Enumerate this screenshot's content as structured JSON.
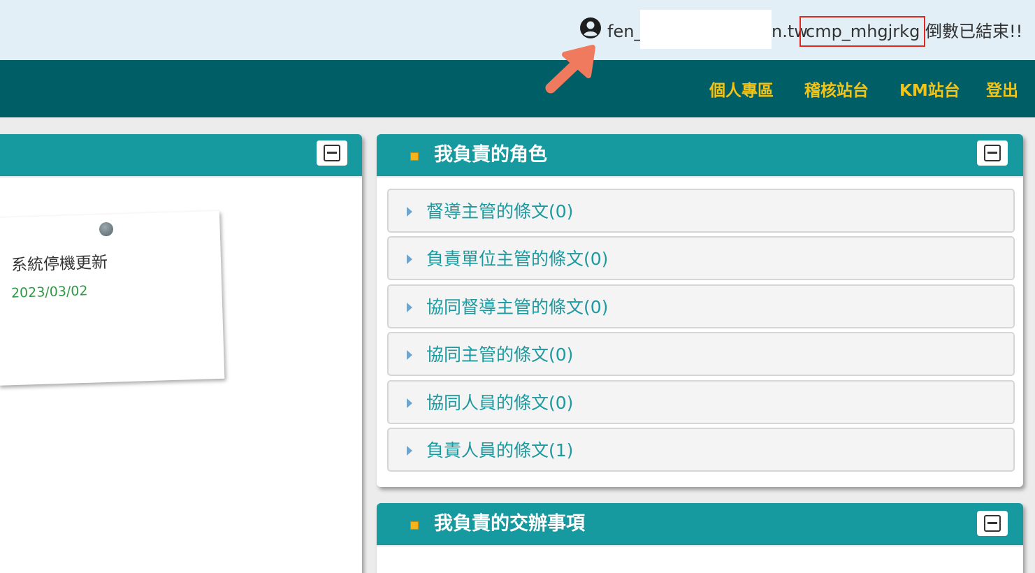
{
  "topbar": {
    "user_prefix": "fen_",
    "user_suffix": "n.tw",
    "session_code": "cmp_mhgjrkg",
    "countdown_text": "倒數已結束!!",
    "user_icon": "user-circle-icon",
    "annotation_color": "#e0281e"
  },
  "nav": {
    "items": [
      {
        "label": "個人專區"
      },
      {
        "label": "稽核站台"
      },
      {
        "label": "KM站台"
      },
      {
        "label": "登出"
      }
    ],
    "link_color": "#f2c418",
    "bar_color": "#005f66"
  },
  "left_panel": {
    "note": {
      "title": "系統停機更新",
      "date": "2023/03/02"
    }
  },
  "roles_panel": {
    "title": "我負責的角色",
    "items": [
      {
        "label": "督導主管的條文(0)"
      },
      {
        "label": "負責單位主管的條文(0)"
      },
      {
        "label": "協同督導主管的條文(0)"
      },
      {
        "label": "協同主管的條文(0)"
      },
      {
        "label": "協同人員的條文(0)"
      },
      {
        "label": "負責人員的條文(1)"
      }
    ]
  },
  "tasks_panel": {
    "title": "我負責的交辦事項"
  },
  "colors": {
    "header_teal": "#16999f",
    "accent_arrow": "#f07a5e"
  }
}
